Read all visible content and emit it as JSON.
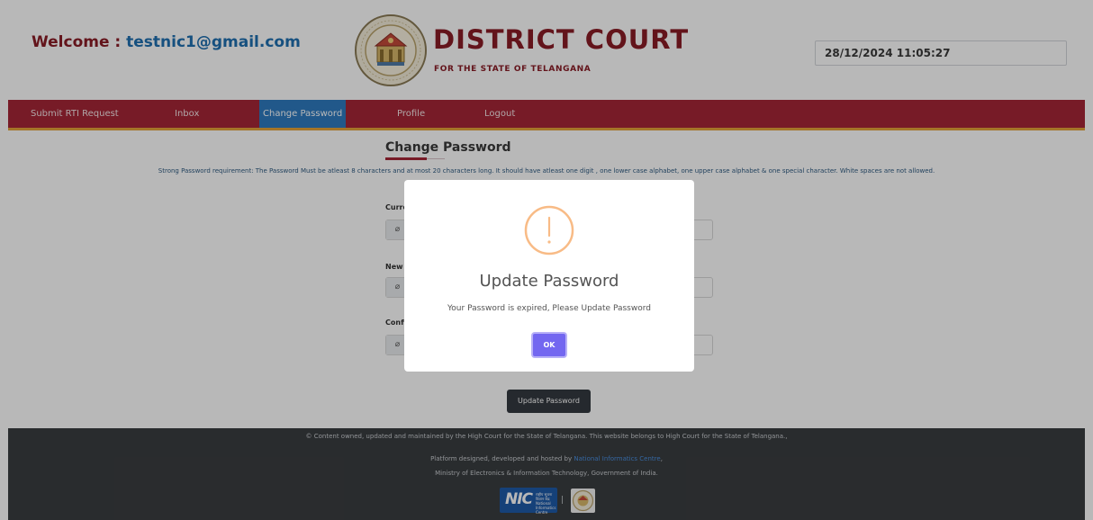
{
  "header": {
    "welcome_prefix": "Welcome : ",
    "welcome_email": "testnic1@gmail.com",
    "court_name": "DISTRICT COURT",
    "court_subtitle": "FOR THE STATE OF TELANGANA",
    "datetime": "28/12/2024 11:05:27",
    "logo_icon": "high-court-seal-icon"
  },
  "nav": {
    "items": [
      {
        "label": "Submit RTI Request"
      },
      {
        "label": "Inbox"
      },
      {
        "label": "Change Password",
        "active": true
      },
      {
        "label": "Profile"
      },
      {
        "label": "Logout"
      }
    ]
  },
  "main": {
    "heading": "Change Password",
    "requirement": "Strong Password requirement: The Password Must be atleast 8 characters and at most 20 characters long. It should have atleast one digit , one lower case alphabet, one upper case alphabet & one special character. White spaces are not allowed.",
    "fields": [
      {
        "label": "Curre",
        "icon": "eye-slash-icon"
      },
      {
        "label": "New",
        "icon": "eye-slash-icon"
      },
      {
        "label": "Confi",
        "icon": "eye-slash-icon"
      }
    ],
    "update_button": "Update Password"
  },
  "footer": {
    "line1": "© Content owned, updated and maintained by the High Court for the State of Telangana. This website belongs to High Court for the State of Telangana.,",
    "line2_prefix": "Platform designed, developed and hosted by ",
    "line2_link": "National Informatics Centre",
    "line2_suffix": ",",
    "line3": "Ministry of Electronics & Information Technology, Government of India.",
    "nic_text": "NIC",
    "nic_sub": "राष्ट्रीय सूचना विज्ञान केंद्र National Informatics Centre",
    "separator": "|"
  },
  "modal": {
    "icon": "warning-icon",
    "title": "Update Password",
    "message": "Your Password is expired, Please Update Password",
    "ok_label": "OK"
  },
  "colors": {
    "brand": "#a52637",
    "nav_active": "#2e7bbf",
    "accent_underline": "#e3a23a",
    "modal_button": "#7367f0",
    "warning": "#f8bb86"
  }
}
